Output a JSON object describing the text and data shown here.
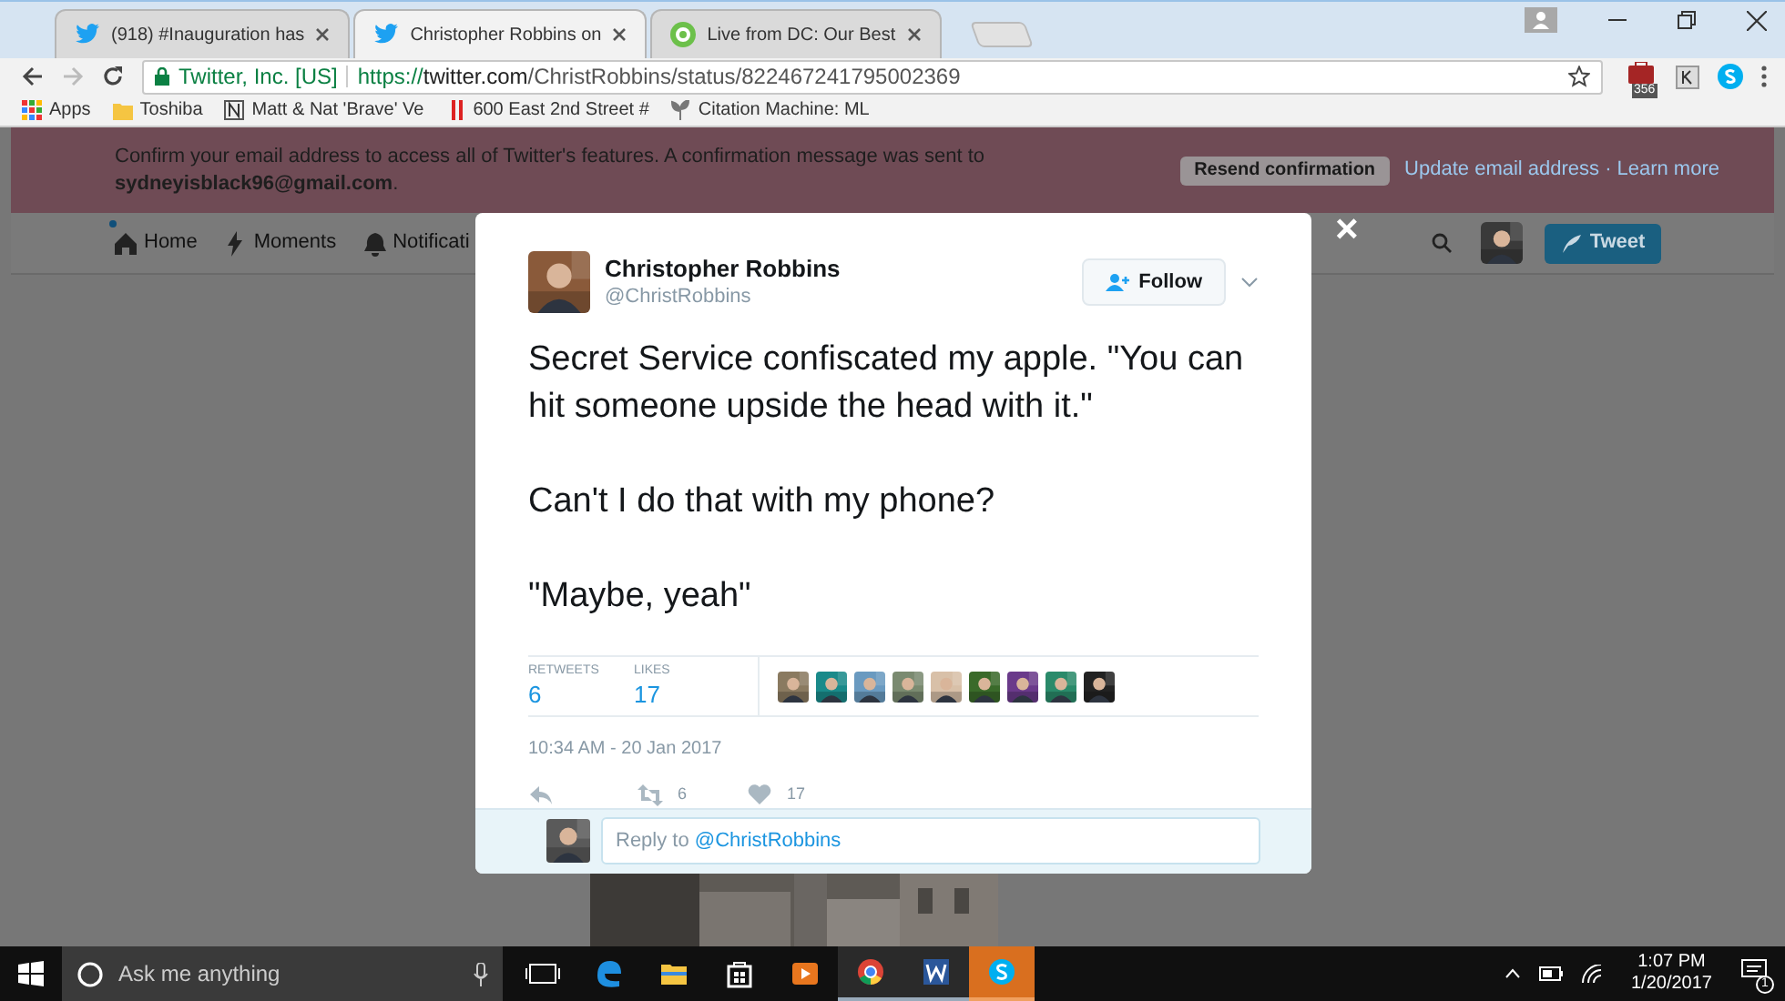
{
  "browser": {
    "tabs": [
      {
        "title": "(918) #Inauguration has",
        "kind": "bird",
        "selected": false
      },
      {
        "title": "Christopher Robbins on",
        "kind": "bird",
        "selected": true
      },
      {
        "title": "Live from DC: Our Best",
        "kind": "s",
        "selected": false
      }
    ],
    "address": {
      "site": "Twitter, Inc. [US]",
      "scheme": "https://",
      "host": "twitter.com",
      "path": "/ChristRobbins/status/822467241795002369"
    },
    "extension_badge": "356",
    "bookmarks": [
      {
        "label": "Apps",
        "kind": "apps"
      },
      {
        "label": "Toshiba",
        "kind": "folder"
      },
      {
        "label": "Matt & Nat 'Brave' Ve",
        "kind": "n"
      },
      {
        "label": "600 East 2nd Street #",
        "kind": "bars"
      },
      {
        "label": "Citation Machine: ML",
        "kind": "leaf"
      }
    ]
  },
  "banner": {
    "message": "Confirm your email address to access all of Twitter's features. A confirmation message was sent to **sydneyisblack96@gmail.com**.",
    "resend": "Resend confirmation",
    "update_link": "Update email address",
    "separator": "·",
    "learn_link": "Learn more"
  },
  "nav": {
    "items": [
      {
        "label": "Home",
        "kind": "home",
        "dot": true
      },
      {
        "label": "Moments",
        "kind": "bolt",
        "dot": false
      },
      {
        "label": "Notificati",
        "kind": "bell",
        "dot": false
      }
    ],
    "tweet_button": "Tweet"
  },
  "modal": {
    "close": "×"
  },
  "tweet": {
    "name": "Christopher Robbins",
    "handle": "@ChristRobbins",
    "follow": "Follow",
    "paragraphs": [
      "Secret Service confiscated my apple. \"You can hit someone upside the head with it.\"",
      "Can't I do that with my phone?",
      "\"Maybe, yeah\""
    ],
    "stats": [
      {
        "label": "RETWEETS",
        "value": "6"
      },
      {
        "label": "LIKES",
        "value": "17"
      }
    ],
    "time": "10:34 AM - 20 Jan 2017",
    "actions": [
      {
        "kind": "reply"
      },
      {
        "kind": "retweet",
        "count": "6"
      },
      {
        "kind": "like",
        "count": "17"
      }
    ],
    "reply": {
      "placeholder": "Reply to ",
      "mention": "@ChristRobbins"
    }
  },
  "taskbar": {
    "search": "Ask me anything",
    "apps": [
      {
        "kind": "taskview",
        "running": false
      },
      {
        "kind": "edge",
        "running": false
      },
      {
        "kind": "explorer",
        "running": false
      },
      {
        "kind": "store",
        "running": false
      },
      {
        "kind": "media",
        "running": false
      },
      {
        "kind": "chrome",
        "running": true
      },
      {
        "kind": "word",
        "running": true
      },
      {
        "kind": "skype",
        "running": true
      }
    ],
    "time": "1:07 PM",
    "date": "1/20/2017",
    "notifications": "1"
  }
}
